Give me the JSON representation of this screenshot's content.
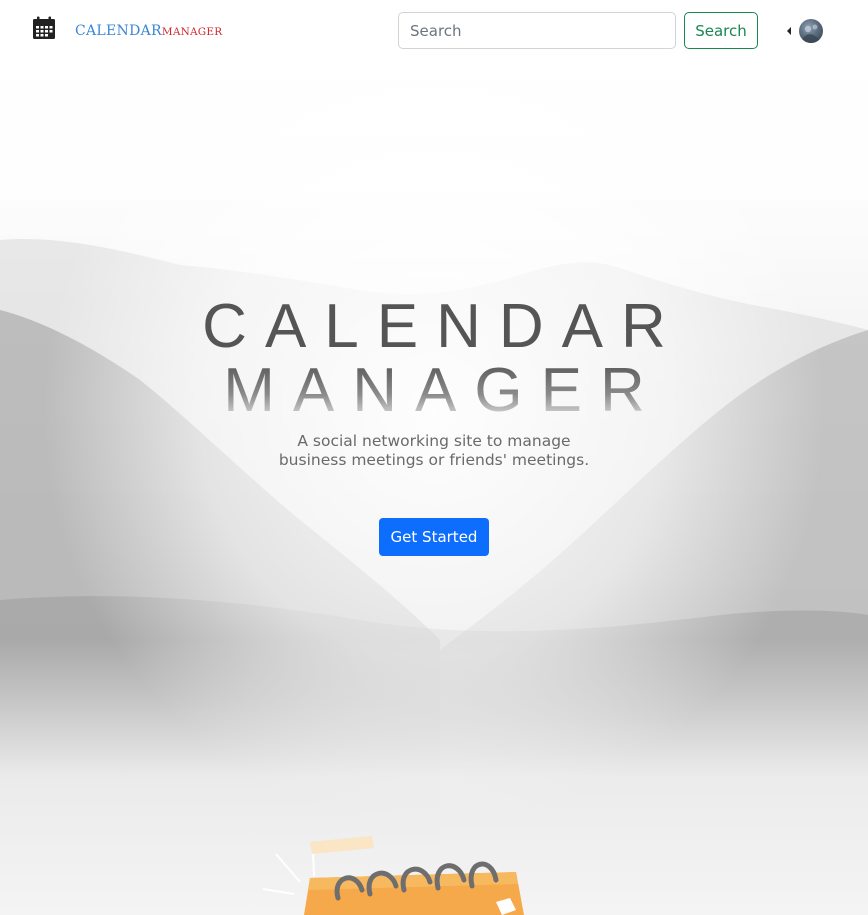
{
  "navbar": {
    "brand_main": "CALENDAR",
    "brand_sub": "MANAGER",
    "brand_icon": "calendar-icon",
    "search_placeholder": "Search",
    "search_value": "",
    "search_button_label": "Search",
    "dropdown_icon": "caret-left-icon",
    "avatar_icon": "user-avatar"
  },
  "hero": {
    "title": "CALENDAR",
    "subtitle": "MANAGER",
    "tagline_line1": "A social networking site to manage",
    "tagline_line2": "business meetings or friends' meetings.",
    "cta_label": "Get Started"
  },
  "colors": {
    "brand_main": "#3a86d6",
    "brand_sub": "#d0262c",
    "search_button": "#198754",
    "cta": "#0d6efd",
    "illustration": "#f5a94a"
  }
}
